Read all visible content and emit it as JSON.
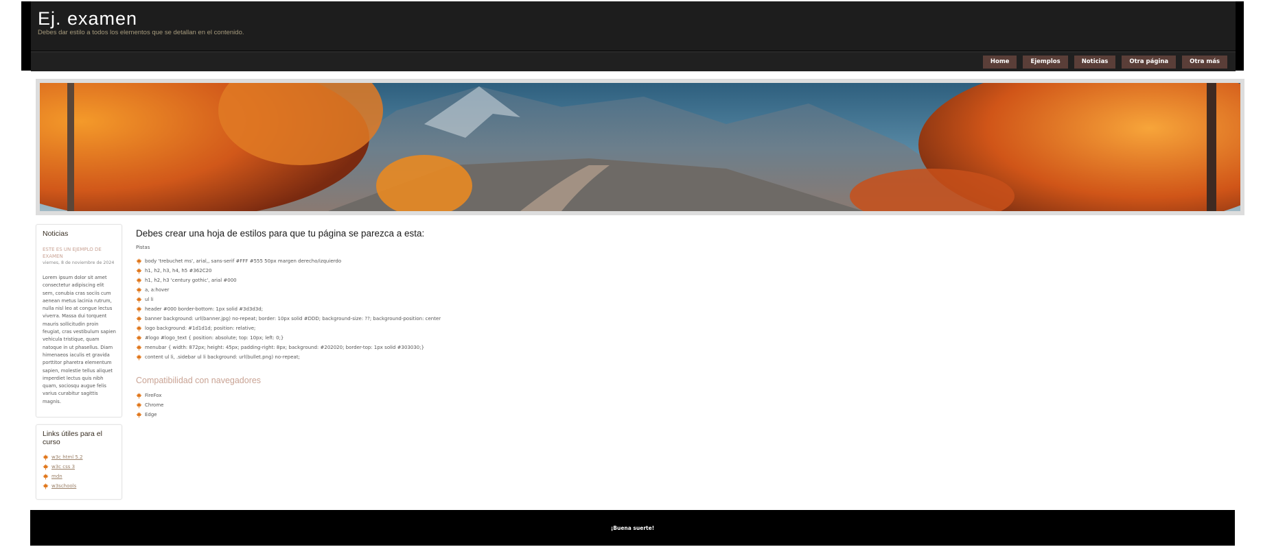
{
  "header": {
    "title": "Ej. examen",
    "subtitle": "Debes dar estilo a todos los elementos que se detallan en el contenido."
  },
  "nav": [
    {
      "label": "Home"
    },
    {
      "label": "Ejemplos"
    },
    {
      "label": "Noticias"
    },
    {
      "label": "Otra página"
    },
    {
      "label": "Otra más"
    }
  ],
  "sidebar": {
    "news": {
      "heading": "Noticias",
      "item_title": "ESTE ES UN EJEMPLO DE EXAMEN",
      "item_date": "viernes, 8 de noviembre de 2024",
      "item_body": "Lorem ipsum dolor sit amet consectetur adipiscing elit sem, conubia cras sociis cum aenean metus lacinia rutrum, nulla nisl leo at congue lectus viverra. Massa dui torquent mauris sollicitudin proin feugiat, cras vestibulum sapien vehicula tristique, quam natoque in ut phasellus. Diam himenaeos iaculis et gravida porttitor pharetra elementum sapien, molestie tellus aliquet imperdiet lectus quis nibh quam, sociosqu augue felis varius curabitur sagittis magnis."
    },
    "links": {
      "heading": "Links útiles para el curso",
      "items": [
        {
          "label": "w3c html 5.2"
        },
        {
          "label": "w3c css 3"
        },
        {
          "label": "mdn"
        },
        {
          "label": "w3schools"
        }
      ]
    }
  },
  "content": {
    "heading": "Debes crear una hoja de estilos para que tu página se parezca a esta:",
    "hint": "Pistas",
    "hints": [
      "body 'trebuchet ms', arial,, sans-serif #FFF #555 50px margen derecho/izquierdo",
      "h1, h2, h3, h4, h5 #362C20",
      "h1, h2, h3 'century gothic', arial #000",
      "a, a:hover",
      "ul li",
      "header #000 border-bottom: 1px solid #3d3d3d;",
      "banner background: url(banner.jpg) no-repeat; border: 10px solid #DDD; background-size: ??; background-position: center",
      "logo background: #1d1d1d; position: relative;",
      "#logo #logo_text { position: absolute; top: 10px; left: 0;}",
      "menubar { width: 872px; height: 45px; padding-right: 8px; background: #202020; border-top: 1px solid #303030;}",
      "content ul li, .sidebar ul li background: url(bullet.png) no-repeat;"
    ],
    "compat_heading": "Compatibilidad con navegadores",
    "browsers": [
      "FireFox",
      "Chrome",
      "Edge"
    ]
  },
  "footer": {
    "text": "¡Buena suerte!"
  },
  "colors": {
    "header_bg": "#000000",
    "logo_bg": "#1d1d1d",
    "menubar_bg": "#202020",
    "nav_button_bg": "#5a3e38",
    "accent_title": "#c9a394",
    "bullet_icon": "#e0761a"
  },
  "icons": {
    "bullet": "maple-leaf-icon"
  }
}
